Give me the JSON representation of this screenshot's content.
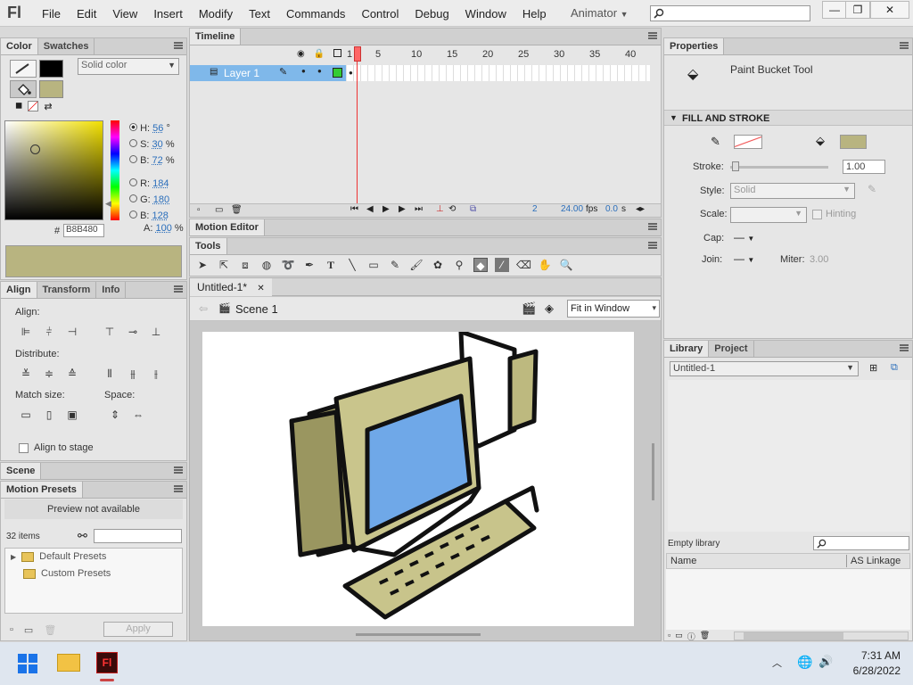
{
  "app": {
    "logo": "Fl",
    "menus": [
      "File",
      "Edit",
      "View",
      "Insert",
      "Modify",
      "Text",
      "Commands",
      "Control",
      "Debug",
      "Window",
      "Help"
    ],
    "workspace": "Animator"
  },
  "color_panel": {
    "tabs": [
      "Color",
      "Swatches"
    ],
    "fill_type": "Solid color",
    "hsb": {
      "h_label": "H:",
      "h": "56",
      "h_unit": "°",
      "s_label": "S:",
      "s": "30",
      "s_unit": "%",
      "b_label": "B:",
      "b": "72",
      "b_unit": "%"
    },
    "rgb": {
      "r_label": "R:",
      "r": "184",
      "g_label": "G:",
      "g": "180",
      "b_label": "B:",
      "b": "128"
    },
    "alpha_label": "A:",
    "alpha": "100",
    "alpha_unit": "%",
    "hex_label": "#",
    "hex": "B8B480",
    "colors": {
      "swatch": "#b8b480",
      "stroke": "#000000"
    }
  },
  "align_panel": {
    "tabs": [
      "Align",
      "Transform",
      "Info"
    ],
    "align_label": "Align:",
    "distribute_label": "Distribute:",
    "match_size_label": "Match size:",
    "space_label": "Space:",
    "align_to_stage": "Align to stage"
  },
  "scene_panel": {
    "tab": "Scene"
  },
  "motion_presets": {
    "tab": "Motion Presets",
    "preview": "Preview not available",
    "count": "32 items",
    "folders": [
      "Default Presets",
      "Custom Presets"
    ],
    "apply": "Apply"
  },
  "timeline": {
    "tab": "Timeline",
    "layer": "Layer 1",
    "frame_numbers": [
      "1",
      "5",
      "10",
      "15",
      "20",
      "25",
      "30",
      "35",
      "40"
    ],
    "current_frame": "2",
    "fps": "24.00",
    "fps_unit": "fps",
    "time": "0.0",
    "time_unit": "s"
  },
  "motion_editor": {
    "tab": "Motion Editor"
  },
  "tools": {
    "tab": "Tools"
  },
  "document": {
    "tab": "Untitled-1*",
    "scene": "Scene 1",
    "zoom": "Fit in Window"
  },
  "properties": {
    "tab": "Properties",
    "tool": "Paint Bucket Tool",
    "section": "FILL AND STROKE",
    "stroke_label": "Stroke:",
    "stroke_value": "1.00",
    "style_label": "Style:",
    "style_value": "Solid",
    "scale_label": "Scale:",
    "hinting": "Hinting",
    "cap_label": "Cap:",
    "join_label": "Join:",
    "miter_label": "Miter:",
    "miter_value": "3.00",
    "fill_color": "#b8b480"
  },
  "library": {
    "tabs": [
      "Library",
      "Project"
    ],
    "document": "Untitled-1",
    "empty": "Empty library",
    "col_name": "Name",
    "col_linkage": "AS Linkage"
  },
  "taskbar": {
    "time": "7:31 AM",
    "date": "6/28/2022"
  }
}
